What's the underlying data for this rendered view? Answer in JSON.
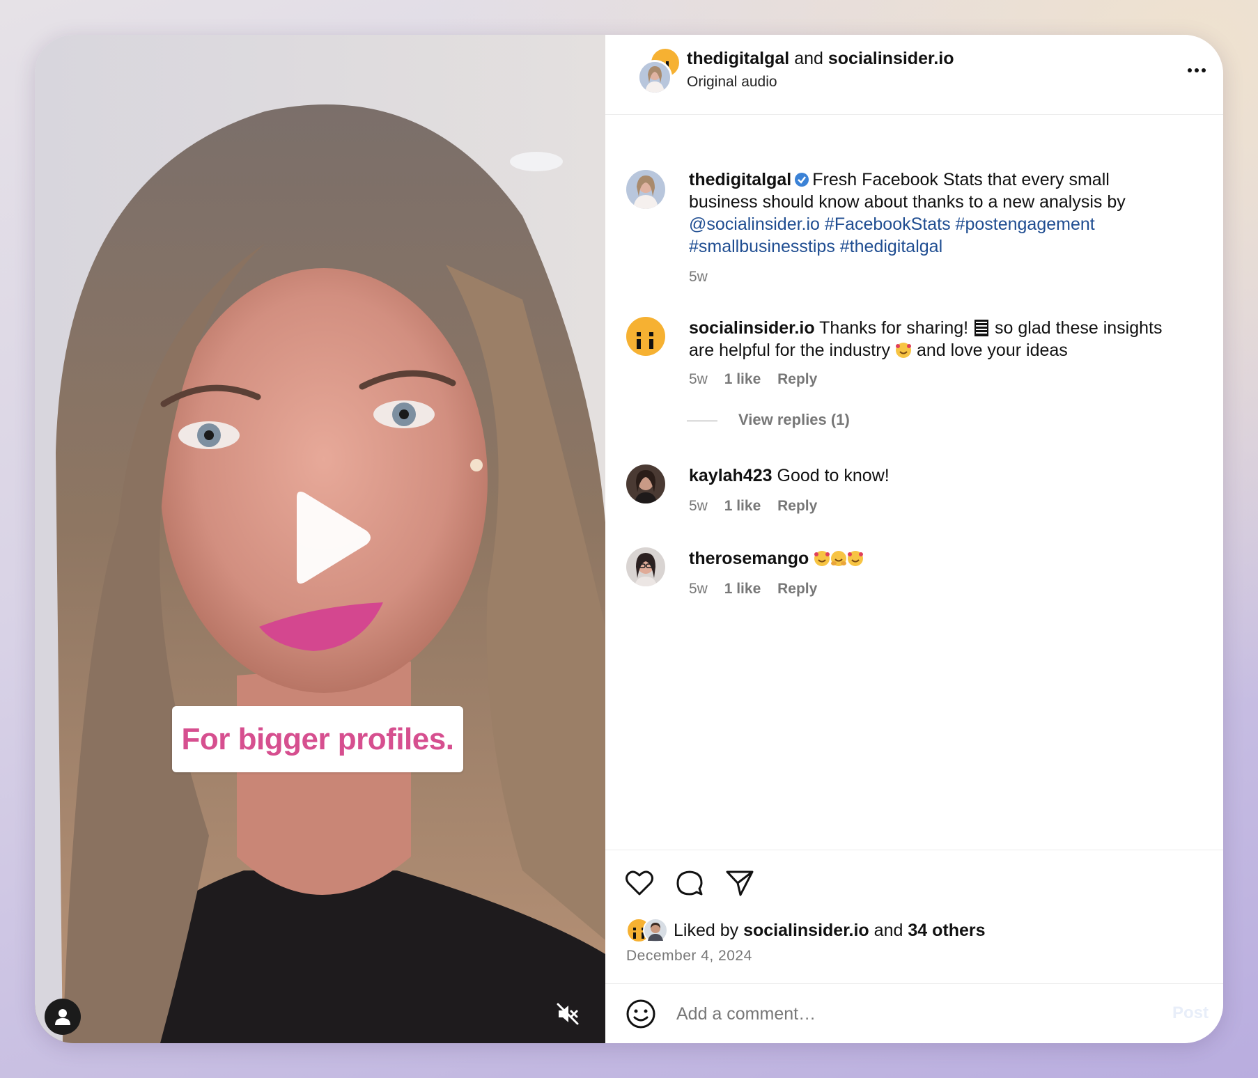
{
  "video": {
    "caption_overlay": "For bigger profiles.",
    "icons": [
      "play-icon",
      "user-tag-icon",
      "muted-icon"
    ]
  },
  "header": {
    "author": "thedigitalgal",
    "joiner": "and",
    "collaborator": "socialinsider.io",
    "audio": "Original audio"
  },
  "post_caption": {
    "user": "thedigitalgal",
    "text": "Fresh Facebook Stats that every small business should know about thanks to a new analysis by",
    "mention": "@socialinsider.io",
    "tags": [
      "#FacebookStats",
      "#postengagement",
      "#smallbusinesstips",
      "#thedigitalgal"
    ],
    "time": "5w"
  },
  "comments": [
    {
      "user": "socialinsider.io",
      "text_part1": "Thanks for sharing!",
      "text_part2": "so glad these insights are helpful for the industry",
      "text_part3": "and love your ideas",
      "time": "5w",
      "likes": "1 like",
      "reply": "Reply"
    },
    {
      "user": "kaylah423",
      "text": "Good to know!",
      "time": "5w",
      "likes": "1 like",
      "reply": "Reply"
    },
    {
      "user": "therosemango",
      "text": "",
      "time": "5w",
      "likes": "1 like",
      "reply": "Reply"
    }
  ],
  "view_replies": "View replies (1)",
  "likes_summary": {
    "prefix": "Liked by",
    "user": "socialinsider.io",
    "joiner": "and",
    "others": "34 others"
  },
  "date": "December 4, 2024",
  "comment_box": {
    "placeholder": "Add a comment…",
    "post_label": "Post"
  },
  "colors": {
    "accent_pink": "#d64f8f",
    "link_blue": "#1f4d91",
    "verified_blue": "#3b82d6",
    "brand_yellow": "#f6b132"
  }
}
